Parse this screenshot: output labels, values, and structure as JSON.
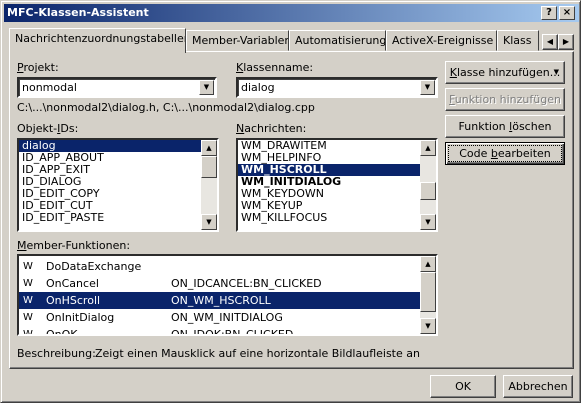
{
  "window": {
    "title": "MFC-Klassen-Assistent",
    "help_btn": "?",
    "close_btn": "×"
  },
  "tabs": [
    {
      "label": "Nachrichtenzuordnungstabellen"
    },
    {
      "label": "Member-Variablen"
    },
    {
      "label": "Automatisierung"
    },
    {
      "label": "ActiveX-Ereignisse"
    },
    {
      "label": "Klass"
    }
  ],
  "tab_scroll": {
    "left": "◀",
    "right": "▶"
  },
  "project": {
    "label_u": "P",
    "label_rest": "rojekt:",
    "value": "nonmodal"
  },
  "classname": {
    "label_u": "K",
    "label_rest": "lassenname:",
    "value": "dialog"
  },
  "paths": "C:\\...\\nonmodal2\\dialog.h, C:\\...\\nonmodal2\\dialog.cpp",
  "objids": {
    "label_pre": "Objekt-",
    "label_u": "I",
    "label_post": "Ds:",
    "items": [
      "dialog",
      "ID_APP_ABOUT",
      "ID_APP_EXIT",
      "ID_DIALOG",
      "ID_EDIT_COPY",
      "ID_EDIT_CUT",
      "ID_EDIT_PASTE"
    ],
    "selected": 0
  },
  "messages": {
    "label_u": "N",
    "label_rest": "achrichten:",
    "items": [
      "WM_DRAWITEM",
      "WM_HELPINFO",
      "WM_HSCROLL",
      "WM_INITDIALOG",
      "WM_KEYDOWN",
      "WM_KEYUP",
      "WM_KILLFOCUS"
    ],
    "selected": 2,
    "bold": [
      2,
      3
    ]
  },
  "buttons": {
    "add_class_u": "K",
    "add_class_rest": "lasse hinzufügen...",
    "add_func_u": "F",
    "add_func_rest": "unktion hinzufügen",
    "del_func_pre": "Funktion ",
    "del_func_u": "l",
    "del_func_rest": "öschen",
    "edit_code_pre": "Code ",
    "edit_code_u": "b",
    "edit_code_rest": "earbeiten",
    "ok": "OK",
    "cancel": "Abbrechen"
  },
  "member_funcs": {
    "label_pre": "",
    "label_u": "M",
    "label_rest": "ember-Funktionen:",
    "rows": [
      {
        "icon": "W",
        "name": "DoDataExchange",
        "map": ""
      },
      {
        "icon": "W",
        "name": "OnCancel",
        "map": "ON_IDCANCEL:BN_CLICKED"
      },
      {
        "icon": "W",
        "name": "OnHScroll",
        "map": "ON_WM_HSCROLL"
      },
      {
        "icon": "W",
        "name": "OnInitDialog",
        "map": "ON_WM_INITDIALOG"
      },
      {
        "icon": "W",
        "name": "OnOK",
        "map": "ON_IDOK:BN_CLICKED"
      }
    ],
    "selected": 2
  },
  "description": {
    "label": "Beschreibung:",
    "text": "Zeigt einen Mausklick auf eine horizontale Bildlaufleiste an"
  },
  "icons": {
    "dropdown": "dropdown-arrow-icon",
    "scroll_up": "up-arrow-icon",
    "scroll_down": "down-arrow-icon"
  }
}
